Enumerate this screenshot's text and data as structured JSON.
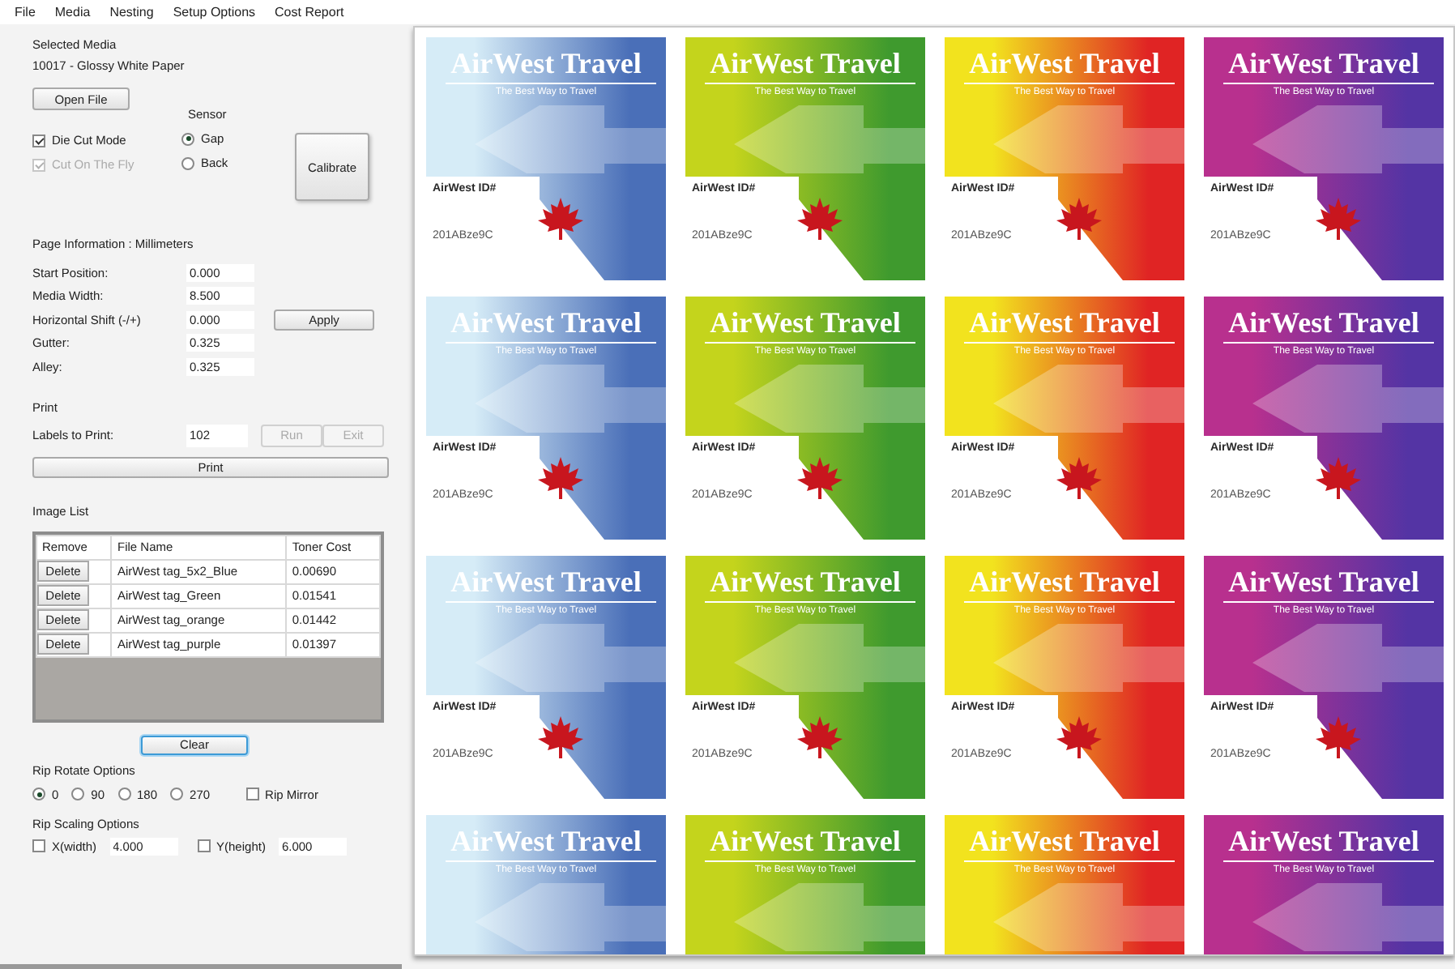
{
  "menu": [
    {
      "label": "File"
    },
    {
      "label": "Media"
    },
    {
      "label": "Nesting"
    },
    {
      "label": "Setup Options"
    },
    {
      "label": "Cost Report"
    }
  ],
  "sidebar": {
    "selected_media_label": "Selected Media",
    "selected_media": "10017 - Glossy White Paper",
    "open_file_button": "Open File",
    "options": [
      {
        "label": "Die Cut Mode",
        "checked": true,
        "disabled": false
      },
      {
        "label": "Cut On The Fly",
        "checked": true,
        "disabled": true
      }
    ],
    "sensor": {
      "label": "Sensor",
      "options": [
        {
          "label": "Gap",
          "selected": true
        },
        {
          "label": "Back",
          "selected": false
        }
      ]
    },
    "calibrate_button": "Calibrate",
    "page_information_label": "Page Information : Millimeters",
    "page_fields": [
      {
        "label": "Start Position:",
        "value": "0.000"
      },
      {
        "label": "Media Width:",
        "value": "8.500"
      },
      {
        "label": "Horizontal Shift (-/+)",
        "value": "0.000"
      },
      {
        "label": "Gutter:",
        "value": "0.325"
      },
      {
        "label": "Alley:",
        "value": "0.325"
      }
    ],
    "apply_button": "Apply",
    "print_label": "Print",
    "labels_to_print": {
      "label": "Labels to Print:",
      "value": "102"
    },
    "print_action_buttons": [
      {
        "label": "Run",
        "disabled": true
      },
      {
        "label": "Exit",
        "disabled": true
      }
    ],
    "print_button": "Print",
    "image_list": {
      "label": "Image List",
      "columns": [
        "Remove",
        "File Name",
        "Toner Cost"
      ],
      "rows": [
        {
          "action": "Delete",
          "file_name": "AirWest tag_5x2_Blue",
          "toner_cost": "0.00690"
        },
        {
          "action": "Delete",
          "file_name": "AirWest tag_Green",
          "toner_cost": "0.01541"
        },
        {
          "action": "Delete",
          "file_name": "AirWest tag_orange",
          "toner_cost": "0.01442"
        },
        {
          "action": "Delete",
          "file_name": "AirWest tag_purple",
          "toner_cost": "0.01397"
        }
      ]
    },
    "clear_button": {
      "label": "Clear",
      "focused": true
    },
    "rotate": {
      "label": "Rip Rotate Options",
      "options": [
        {
          "label": "0",
          "selected": true
        },
        {
          "label": "90",
          "selected": false
        },
        {
          "label": "180",
          "selected": false
        },
        {
          "label": "270",
          "selected": false
        }
      ],
      "mirror": {
        "label": "Rip Mirror",
        "checked": false
      }
    },
    "scaling": {
      "label": "Rip Scaling Options",
      "fields": [
        {
          "label": "X(width)",
          "checked": false,
          "value": "4.000"
        },
        {
          "label": "Y(height)",
          "checked": false,
          "value": "6.000"
        }
      ]
    }
  },
  "preview": {
    "rows": [
      [
        {
          "title": "AirWest Travel",
          "tagline": "The Best Way to Travel",
          "id_label": "AirWest ID#",
          "code": "201ABze9C",
          "color": "#4a6fb8"
        },
        {
          "title": "AirWest Travel",
          "tagline": "The Best Way to Travel",
          "id_label": "AirWest ID#",
          "code": "201ABze9C",
          "color": "#3f9a2e"
        },
        {
          "title": "AirWest Travel",
          "tagline": "The Best Way to Travel",
          "id_label": "AirWest ID#",
          "code": "201ABze9C",
          "color": "#e02424"
        },
        {
          "title": "AirWest Travel",
          "tagline": "The Best Way to Travel",
          "id_label": "AirWest ID#",
          "code": "201ABze9C",
          "color": "#5434a4"
        }
      ],
      [
        {
          "title": "AirWest Travel",
          "tagline": "The Best Way to Travel",
          "id_label": "AirWest ID#",
          "code": "201ABze9C",
          "color": "#4a6fb8"
        },
        {
          "title": "AirWest Travel",
          "tagline": "The Best Way to Travel",
          "id_label": "AirWest ID#",
          "code": "201ABze9C",
          "color": "#3f9a2e"
        },
        {
          "title": "AirWest Travel",
          "tagline": "The Best Way to Travel",
          "id_label": "AirWest ID#",
          "code": "201ABze9C",
          "color": "#e02424"
        },
        {
          "title": "AirWest Travel",
          "tagline": "The Best Way to Travel",
          "id_label": "AirWest ID#",
          "code": "201ABze9C",
          "color": "#5434a4"
        }
      ],
      [
        {
          "title": "AirWest Travel",
          "tagline": "The Best Way to Travel",
          "id_label": "AirWest ID#",
          "code": "201ABze9C",
          "color": "#4a6fb8"
        },
        {
          "title": "AirWest Travel",
          "tagline": "The Best Way to Travel",
          "id_label": "AirWest ID#",
          "code": "201ABze9C",
          "color": "#3f9a2e"
        },
        {
          "title": "AirWest Travel",
          "tagline": "The Best Way to Travel",
          "id_label": "AirWest ID#",
          "code": "201ABze9C",
          "color": "#e02424"
        },
        {
          "title": "AirWest Travel",
          "tagline": "The Best Way to Travel",
          "id_label": "AirWest ID#",
          "code": "201ABze9C",
          "color": "#5434a4"
        }
      ],
      [
        {
          "title": "AirWest Travel",
          "tagline": "The Best Way to Travel",
          "color": "#4a6fb8"
        },
        {
          "title": "AirWest Travel",
          "tagline": "The Best Way to Travel",
          "color": "#3f9a2e"
        },
        {
          "title": "AirWest Travel",
          "tagline": "The Best Way to Travel",
          "color": "#e02424"
        },
        {
          "title": "AirWest Travel",
          "tagline": "The Best Way to Travel",
          "color": "#5434a4"
        }
      ]
    ]
  }
}
